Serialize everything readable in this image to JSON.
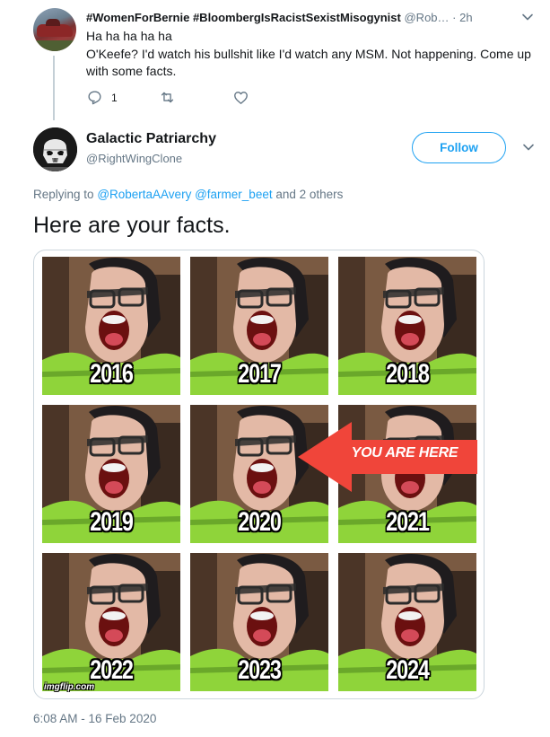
{
  "parent_tweet": {
    "display_name": "#WomenForBernie #BloombergIsRacistSexistMisogynist",
    "handle": "@Rob…",
    "separator": "·",
    "time": "2h",
    "lines": [
      "Ha ha ha ha ha",
      "O'Keefe? I'd watch his bullshit like I'd watch any MSM. Not happening. Come up",
      "with some facts."
    ],
    "actions": {
      "reply_count": "1",
      "retweet_count": "",
      "like_count": ""
    }
  },
  "main_tweet": {
    "display_name": "Galactic Patriarchy",
    "handle": "@RightWingClone",
    "follow_label": "Follow",
    "replying_prefix": "Replying to",
    "replying_mentions": [
      "@RobertaAAvery",
      "@farmer_beet"
    ],
    "replying_suffix": "and 2 others",
    "text": "Here are your facts.",
    "media": {
      "years": [
        "2016",
        "2017",
        "2018",
        "2019",
        "2020",
        "2021",
        "2022",
        "2023",
        "2024"
      ],
      "arrow_label": "YOU ARE HERE",
      "watermark": "imgflip.com"
    },
    "timestamp": "6:08 AM - 16 Feb 2020"
  },
  "colors": {
    "twitter_blue": "#1da1f2",
    "secondary_text": "#657786",
    "primary_text": "#14171a",
    "arrow_red": "#f0453a",
    "jacket_green": "#8fd43a"
  },
  "icons": {
    "caret": "chevron-down-icon",
    "reply": "reply-icon",
    "retweet": "retweet-icon",
    "like": "heart-icon"
  }
}
